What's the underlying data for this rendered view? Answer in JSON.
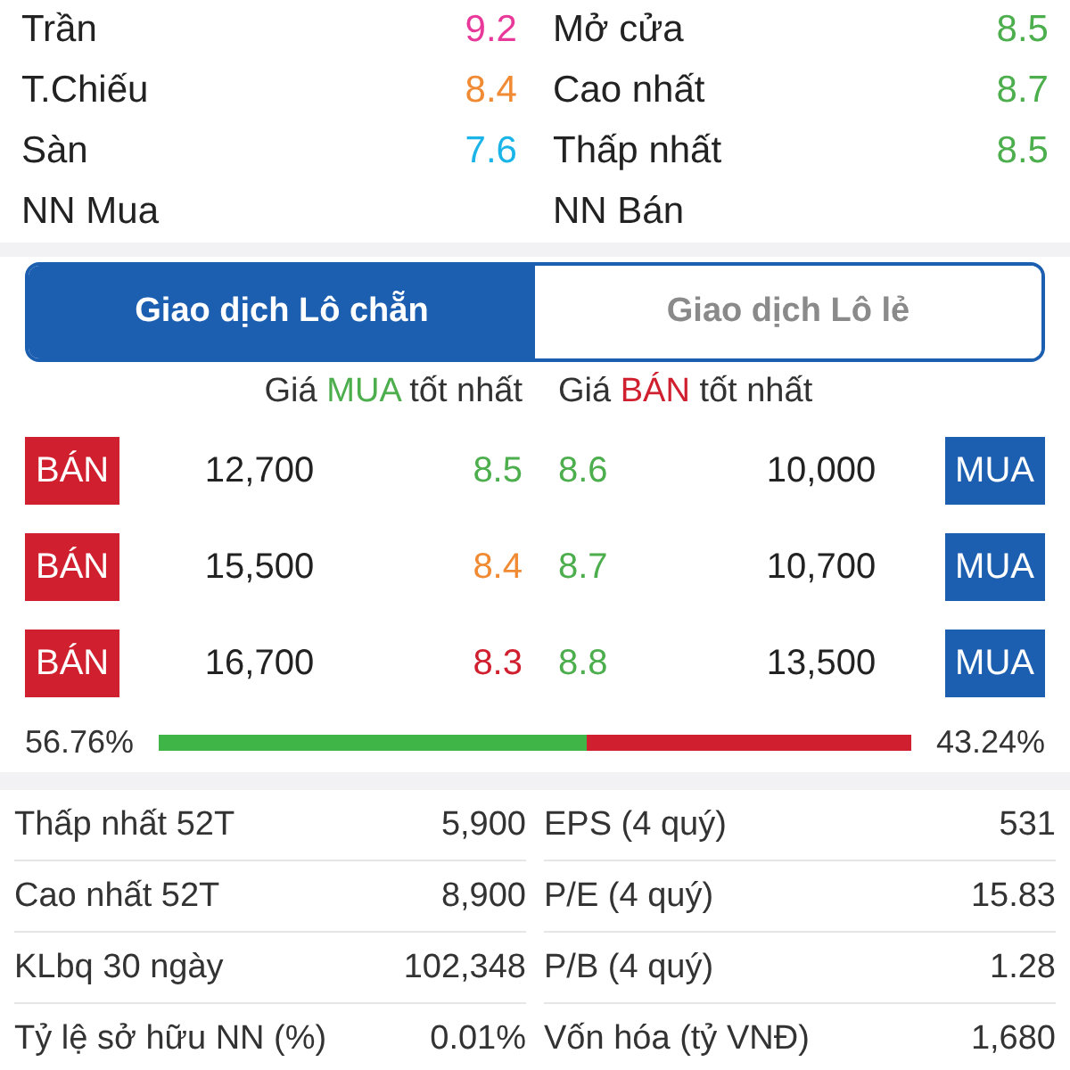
{
  "quote_rows": [
    {
      "left": {
        "label": "Trần",
        "value": "9.2",
        "color": "#e8399b"
      },
      "right": {
        "label": "Mở cửa",
        "value": "8.5",
        "color": "#4cae4c"
      }
    },
    {
      "left": {
        "label": "T.Chiếu",
        "value": "8.4",
        "color": "#f08a33"
      },
      "right": {
        "label": "Cao nhất",
        "value": "8.7",
        "color": "#4cae4c"
      }
    },
    {
      "left": {
        "label": "Sàn",
        "value": "7.6",
        "color": "#1ab4e8"
      },
      "right": {
        "label": "Thấp nhất",
        "value": "8.5",
        "color": "#4cae4c"
      }
    },
    {
      "left": {
        "label": "NN Mua"
      },
      "right": {
        "label": "NN Bán"
      }
    }
  ],
  "tabs": [
    {
      "label": "Giao dịch Lô chẵn",
      "selected": true
    },
    {
      "label": "Giao dịch Lô lẻ",
      "selected": false
    }
  ],
  "order_book": {
    "bid_header": {
      "before": "Giá",
      "emphasis": "MUA",
      "after": "tốt nhất",
      "color": "#4cae4c"
    },
    "ask_header": {
      "before": "Giá",
      "emphasis": "BÁN",
      "after": "tốt nhất",
      "color": "#d0202f"
    },
    "rows": [
      {
        "sell_button": "BÁN",
        "bid_volume": "12,700",
        "bid": {
          "price": "8.5",
          "color": "#4cae4c"
        },
        "ask": {
          "price": "8.6",
          "color": "#4cae4c"
        },
        "ask_volume": "10,000",
        "buy_button": "MUA"
      },
      {
        "sell_button": "BÁN",
        "bid_volume": "15,500",
        "bid": {
          "price": "8.4",
          "color": "#f08a33"
        },
        "ask": {
          "price": "8.7",
          "color": "#4cae4c"
        },
        "ask_volume": "10,700",
        "buy_button": "MUA"
      },
      {
        "sell_button": "BÁN",
        "bid_volume": "16,700",
        "bid": {
          "price": "8.3",
          "color": "#d0202f"
        },
        "ask": {
          "price": "8.8",
          "color": "#4cae4c"
        },
        "ask_volume": "13,500",
        "buy_button": "MUA"
      }
    ],
    "ratio": {
      "buy_percent": "56.76%",
      "sell_percent": "43.24%",
      "level": 0.5676
    }
  },
  "fundamentals": [
    {
      "left_label": "Thấp nhất 52T",
      "left_value": "5,900",
      "right_label": "EPS (4 quý)",
      "right_value": "531"
    },
    {
      "left_label": "Cao nhất 52T",
      "left_value": "8,900",
      "right_label": "P/E (4 quý)",
      "right_value": "15.83"
    },
    {
      "left_label": "KLbq 30 ngày",
      "left_value": "102,348",
      "right_label": "P/B (4 quý)",
      "right_value": "1.28"
    },
    {
      "left_label": "Tỷ lệ sở hữu NN (%)",
      "left_value": "0.01%",
      "right_label": "Vốn hóa (tỷ VNĐ)",
      "right_value": "1,680"
    }
  ]
}
